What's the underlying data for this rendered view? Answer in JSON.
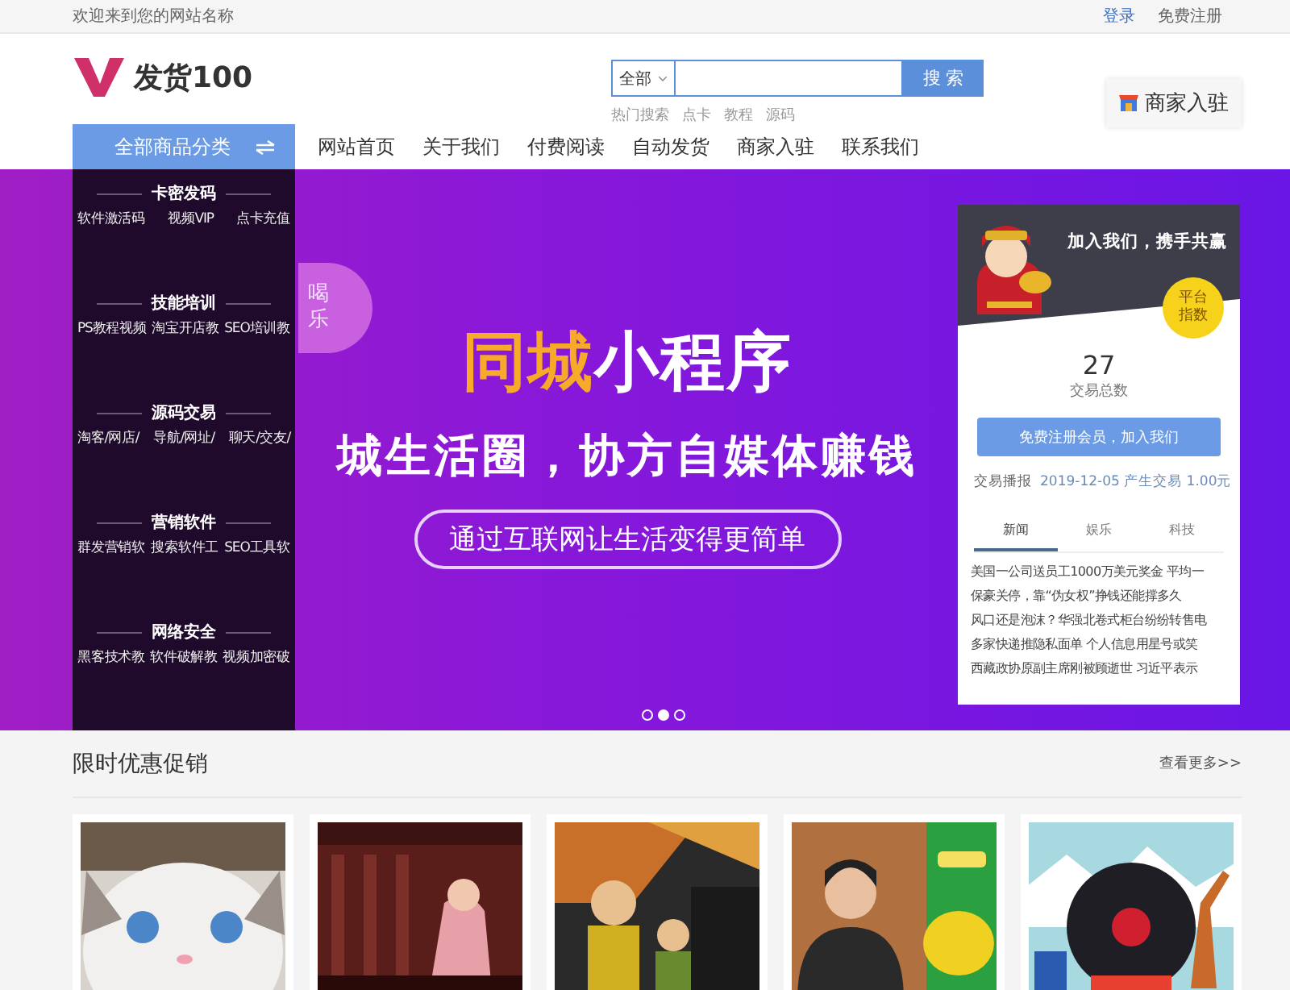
{
  "topbar": {
    "welcome": "欢迎来到您的网站名称",
    "links": [
      "登录",
      "免费注册"
    ]
  },
  "logo": {
    "name": "发货100"
  },
  "search": {
    "scope": "全部",
    "button": "搜 索",
    "hot_label": "热门搜索",
    "hot": [
      "点卡",
      "教程",
      "源码"
    ]
  },
  "merchant_button": "商家入驻",
  "nav": {
    "category_button": "全部商品分类",
    "items": [
      "网站首页",
      "关于我们",
      "付费阅读",
      "自动发货",
      "商家入驻",
      "联系我们"
    ]
  },
  "categories": [
    {
      "title": "卡密发码",
      "items": [
        "软件激活码",
        "视频VIP",
        "点卡充值"
      ]
    },
    {
      "title": "技能培训",
      "items": [
        "PS教程视频",
        "淘宝开店教",
        "SEO培训教"
      ]
    },
    {
      "title": "源码交易",
      "items": [
        "淘客/网店/",
        "导航/网址/",
        "聊天/交友/"
      ]
    },
    {
      "title": "营销软件",
      "items": [
        "群发营销软",
        "搜索软件工",
        "SEO工具软"
      ]
    },
    {
      "title": "网络安全",
      "items": [
        "黑客技术教",
        "软件破解教",
        "视频加密破"
      ]
    }
  ],
  "banner": {
    "badge": [
      "喝",
      "乐"
    ],
    "headline_accent": "同城",
    "headline": "小程序",
    "subline": "城生活圈，协方自媒体赚钱",
    "pill": "通过互联网让生活变得更简单",
    "dots": [
      {
        "selected": false
      },
      {
        "selected": true
      },
      {
        "selected": false
      }
    ]
  },
  "stats_card": {
    "title": "加入我们，携手共赢",
    "badge": "平台指数",
    "count": "27",
    "count_label": "交易总数",
    "button": "免费注册会员，加入我们",
    "report_label": "交易播报",
    "report": "2019-12-05 产生交易 1.00元",
    "tabs": [
      {
        "label": "新闻",
        "selected": true
      },
      {
        "label": "娱乐",
        "selected": false
      },
      {
        "label": "科技",
        "selected": false
      }
    ],
    "news": [
      "美国一公司送员工1000万美元奖金 平均一",
      "保豪关停，靠“伪女权”挣钱还能撑多久",
      "风口还是泡沫？华强北卷式柜台纷纷转售电",
      "多家快递推隐私面单 个人信息用星号或笑",
      "西藏政协原副主席刚被顾逝世 习近平表示"
    ]
  },
  "promo": {
    "title": "限时优惠促销",
    "more": "查看更多>>"
  }
}
